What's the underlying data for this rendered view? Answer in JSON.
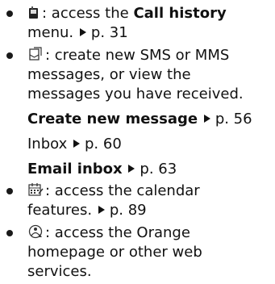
{
  "items": [
    {
      "icon": "call-history-icon",
      "lines": [
        {
          "pre": ": access the ",
          "bold": "Call history",
          "post": ""
        },
        {
          "pre": "menu.",
          "page": "p. 31"
        }
      ]
    },
    {
      "icon": "messages-icon",
      "lines": [
        {
          "text": ": create new SMS or MMS"
        },
        {
          "text": "messages, or view the"
        },
        {
          "text": "messages you have received."
        }
      ],
      "links": [
        {
          "label": "Create new message",
          "page": "p. 56",
          "bold": true
        },
        {
          "label": "Inbox",
          "page": "p. 60",
          "bold": false
        },
        {
          "label": "Email inbox",
          "page": "p. 63",
          "bold": true
        }
      ]
    },
    {
      "icon": "calendar-icon",
      "lines": [
        {
          "text": ": access the calendar"
        },
        {
          "pre": "features.",
          "page": "p. 89"
        }
      ]
    },
    {
      "icon": "orange-web-icon",
      "lines": [
        {
          "text": ": access the Orange"
        },
        {
          "text": "homepage or other web"
        },
        {
          "text": "services."
        }
      ]
    }
  ]
}
